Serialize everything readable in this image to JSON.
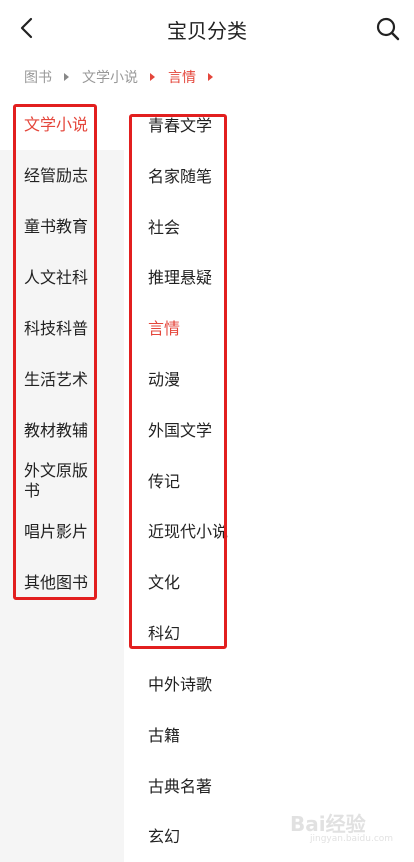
{
  "header": {
    "title": "宝贝分类",
    "back_icon": "chevron-left-icon",
    "search_icon": "search-icon"
  },
  "breadcrumb": [
    "图书",
    "文学小说",
    "言情"
  ],
  "left_categories": [
    {
      "label": "文学小说",
      "active": true
    },
    {
      "label": "经管励志"
    },
    {
      "label": "童书教育"
    },
    {
      "label": "人文社科"
    },
    {
      "label": "科技科普"
    },
    {
      "label": "生活艺术"
    },
    {
      "label": "教材教辅"
    },
    {
      "label": "外文原版书"
    },
    {
      "label": "唱片影片"
    },
    {
      "label": "其他图书"
    }
  ],
  "right_categories": [
    {
      "label": "青春文学"
    },
    {
      "label": "名家随笔"
    },
    {
      "label": "社会"
    },
    {
      "label": "推理悬疑"
    },
    {
      "label": "言情",
      "active": true
    },
    {
      "label": "动漫"
    },
    {
      "label": "外国文学"
    },
    {
      "label": "传记"
    },
    {
      "label": "近现代小说"
    },
    {
      "label": "文化"
    },
    {
      "label": "科幻"
    },
    {
      "label": "中外诗歌"
    },
    {
      "label": "古籍"
    },
    {
      "label": "古典名著"
    },
    {
      "label": "玄幻"
    }
  ],
  "colors": {
    "accent": "#e4463b",
    "annotation_box": "#e21f1f",
    "left_panel_bg": "#f5f5f5"
  },
  "watermark": {
    "text": "Bai经验",
    "sub": "jingyan.baidu.com"
  }
}
